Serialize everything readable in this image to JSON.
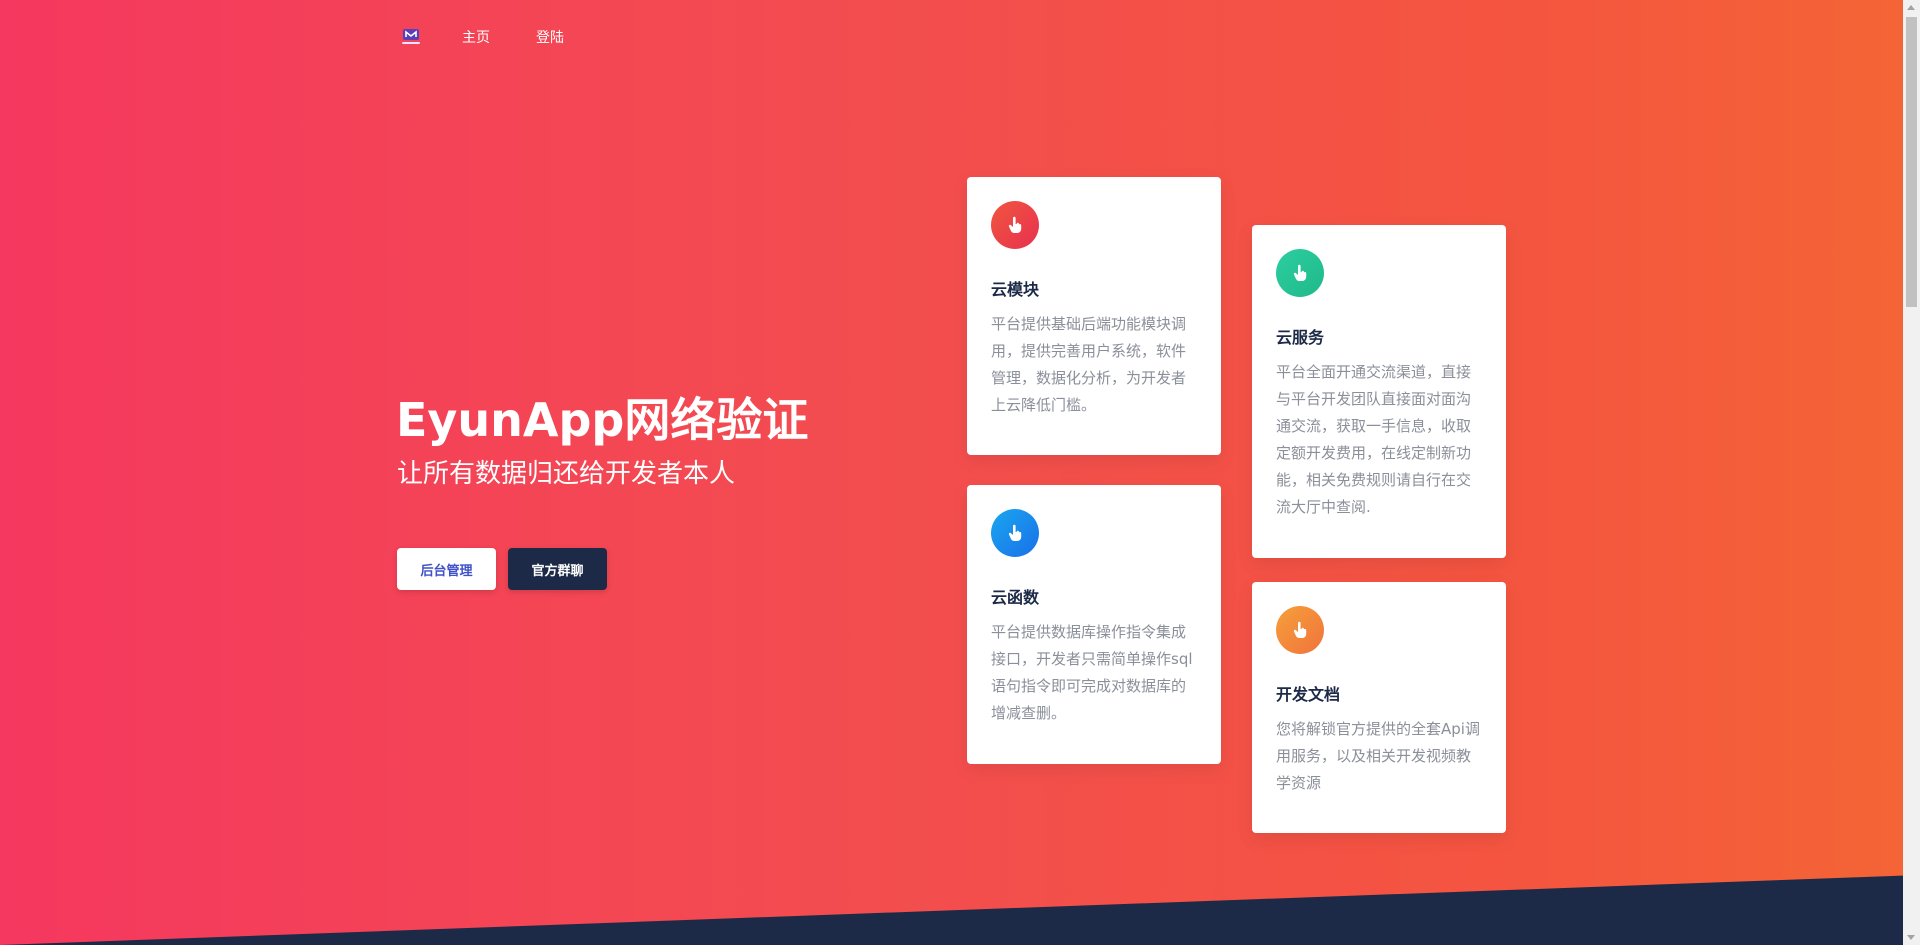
{
  "nav": {
    "logo_icon": "eyunapp-logo-icon",
    "links": [
      {
        "label": "主页"
      },
      {
        "label": "登陆"
      }
    ]
  },
  "hero": {
    "title": "EyunApp网络验证",
    "subtitle": "让所有数据归还给开发者本人",
    "buttons": {
      "admin_label": "后台管理",
      "chat_label": "官方群聊"
    }
  },
  "cards": [
    {
      "title": "云模块",
      "text": "平台提供基础后端功能模块调用，提供完善用户系统，软件管理，数据化分析，为开发者上云降低门槛。",
      "icon": "pointer-hand-icon",
      "icon_gradient": [
        "#f0563f",
        "#e8304f"
      ]
    },
    {
      "title": "云服务",
      "text": "平台全面开通交流渠道，直接与平台开发团队直接面对面沟通交流，获取一手信息，收取定额开发费用，在线定制新功能，相关免费规则请自行在交流大厅中查阅.",
      "icon": "pointer-hand-icon",
      "icon_gradient": [
        "#2dcea0",
        "#1fb98a"
      ]
    },
    {
      "title": "云函数",
      "text": "平台提供数据库操作指令集成接口，开发者只需简单操作sql语句指令即可完成对数据库的增减查删。",
      "icon": "pointer-hand-icon",
      "icon_gradient": [
        "#19a7f0",
        "#1a6fe8"
      ]
    },
    {
      "title": "开发文档",
      "text": "您将解锁官方提供的全套Api调用服务，以及相关开发视频教学资源",
      "icon": "pointer-hand-icon",
      "icon_gradient": [
        "#f6a03a",
        "#f0733c"
      ]
    }
  ],
  "colors": {
    "bg_start": "#f5385f",
    "bg_end": "#f46535",
    "dark_navy": "#1d2a47",
    "admin_button_text": "#3f51c8"
  }
}
